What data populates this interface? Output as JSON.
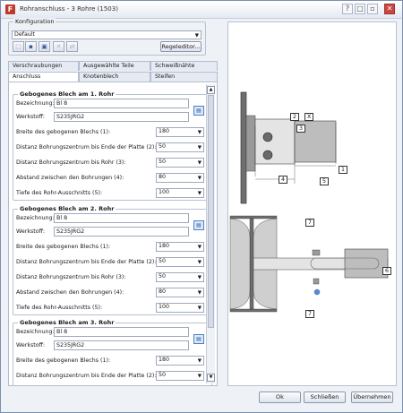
{
  "window": {
    "title": "Rohranschluss - 3 Rohre (1503)",
    "icon_letter": "F",
    "controls": [
      "?",
      "□",
      "▫",
      "✕"
    ]
  },
  "konfiguration": {
    "group_label": "Konfiguration",
    "selected": "Default",
    "toolbar_icons": [
      "new-icon",
      "save-icon",
      "save-as-icon",
      "delete-icon",
      "refresh-icon"
    ],
    "regeleditor_label": "Regeleditor..."
  },
  "tabs": {
    "row1": [
      "Verschraubungen",
      "Ausgewählte Teile",
      "Schweißnähte"
    ],
    "row2": [
      "Anschluss",
      "Knotenblech",
      "Steifen"
    ],
    "active": "Anschluss"
  },
  "labels": {
    "bezeichnung": "Bezeichnung:",
    "werkstoff": "Werkstoff:",
    "breite": "Breite des gebogenen Blechs (1):",
    "distanz_ende": "Distanz Bohrungszentrum bis Ende der Platte (2):",
    "distanz_rohr": "Distanz Bohrungszentrum bis Rohr (3):",
    "abstand": "Abstand zwischen den Bohrungen (4):",
    "tiefe": "Tiefe des Rohr-Ausschnitts (5):"
  },
  "sections": [
    {
      "title": "Gebogenes Blech am 1. Rohr",
      "bezeichnung": "Bl 8",
      "werkstoff": "S235JRG2",
      "breite": "180",
      "distanz_ende": "50",
      "distanz_rohr": "50",
      "abstand": "80",
      "tiefe": "100"
    },
    {
      "title": "Gebogenes Blech am 2. Rohr",
      "bezeichnung": "Bl 8",
      "werkstoff": "S235JRG2",
      "breite": "180",
      "distanz_ende": "50",
      "distanz_rohr": "50",
      "abstand": "80",
      "tiefe": "100"
    },
    {
      "title": "Gebogenes Blech am 3. Rohr",
      "bezeichnung": "Bl 8",
      "werkstoff": "S235JRG2",
      "breite": "180",
      "distanz_ende": "50"
    }
  ],
  "figure": {
    "callouts": [
      "1",
      "2",
      "3",
      "4",
      "5",
      "6",
      "7",
      "7",
      "X"
    ]
  },
  "buttons": {
    "ok": "Ok",
    "schliessen": "Schließen",
    "uebernehmen": "Übernehmen"
  },
  "colors": {
    "steel_dark": "#6e6e6e",
    "steel_light": "#bdbdbd",
    "window_bg": "#eef1f6"
  }
}
